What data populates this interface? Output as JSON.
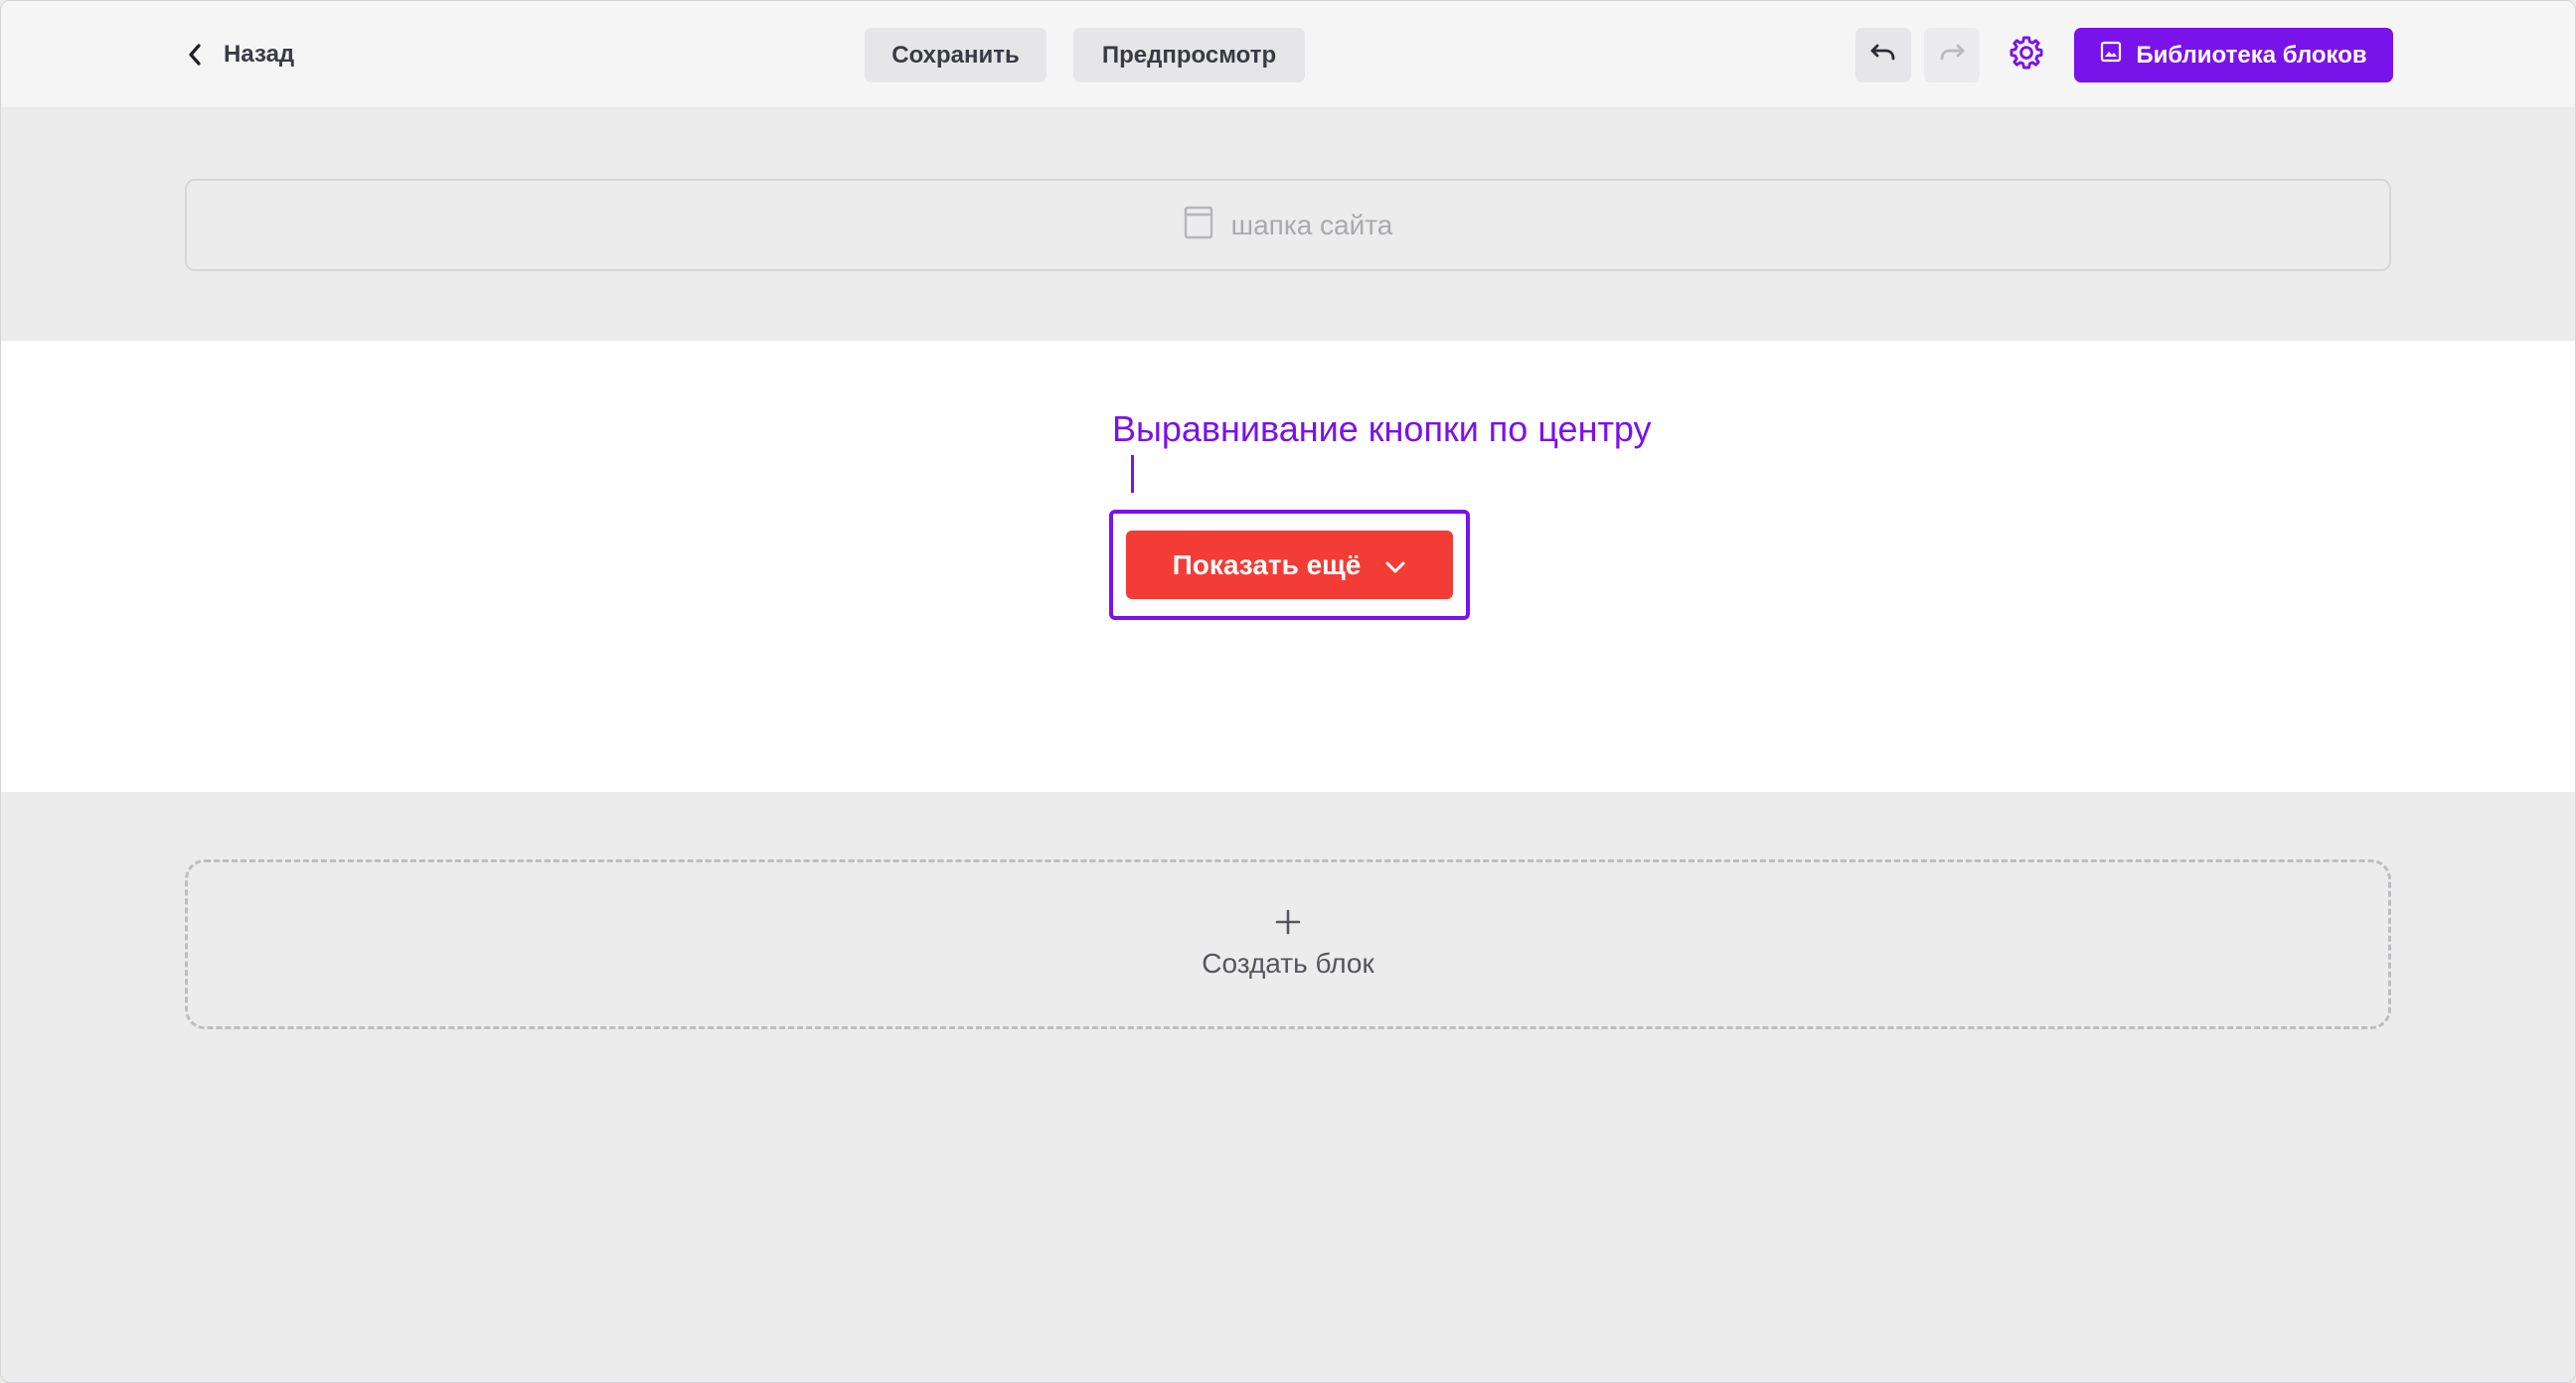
{
  "toolbar": {
    "back_label": "Назад",
    "save_label": "Сохранить",
    "preview_label": "Предпросмотр",
    "library_label": "Библиотека блоков",
    "icons": {
      "back": "chevron-left-icon",
      "undo": "undo-icon",
      "redo": "redo-icon",
      "settings": "gear-icon",
      "library": "image-icon"
    }
  },
  "header_placeholder": {
    "label": "шапка сайта",
    "icon": "page-icon"
  },
  "content": {
    "hint": "Выравнивание кнопки по центру",
    "button_label": "Показать ещё",
    "button_icon": "chevron-down-icon"
  },
  "create_block": {
    "label": "Создать блок",
    "icon": "plus-icon"
  },
  "colors": {
    "accent": "#7a12ea",
    "button": "#f33c35",
    "toolbar_bg": "#f5f5f5",
    "canvas_bg": "#ececec",
    "block_bg": "#ffffff"
  }
}
